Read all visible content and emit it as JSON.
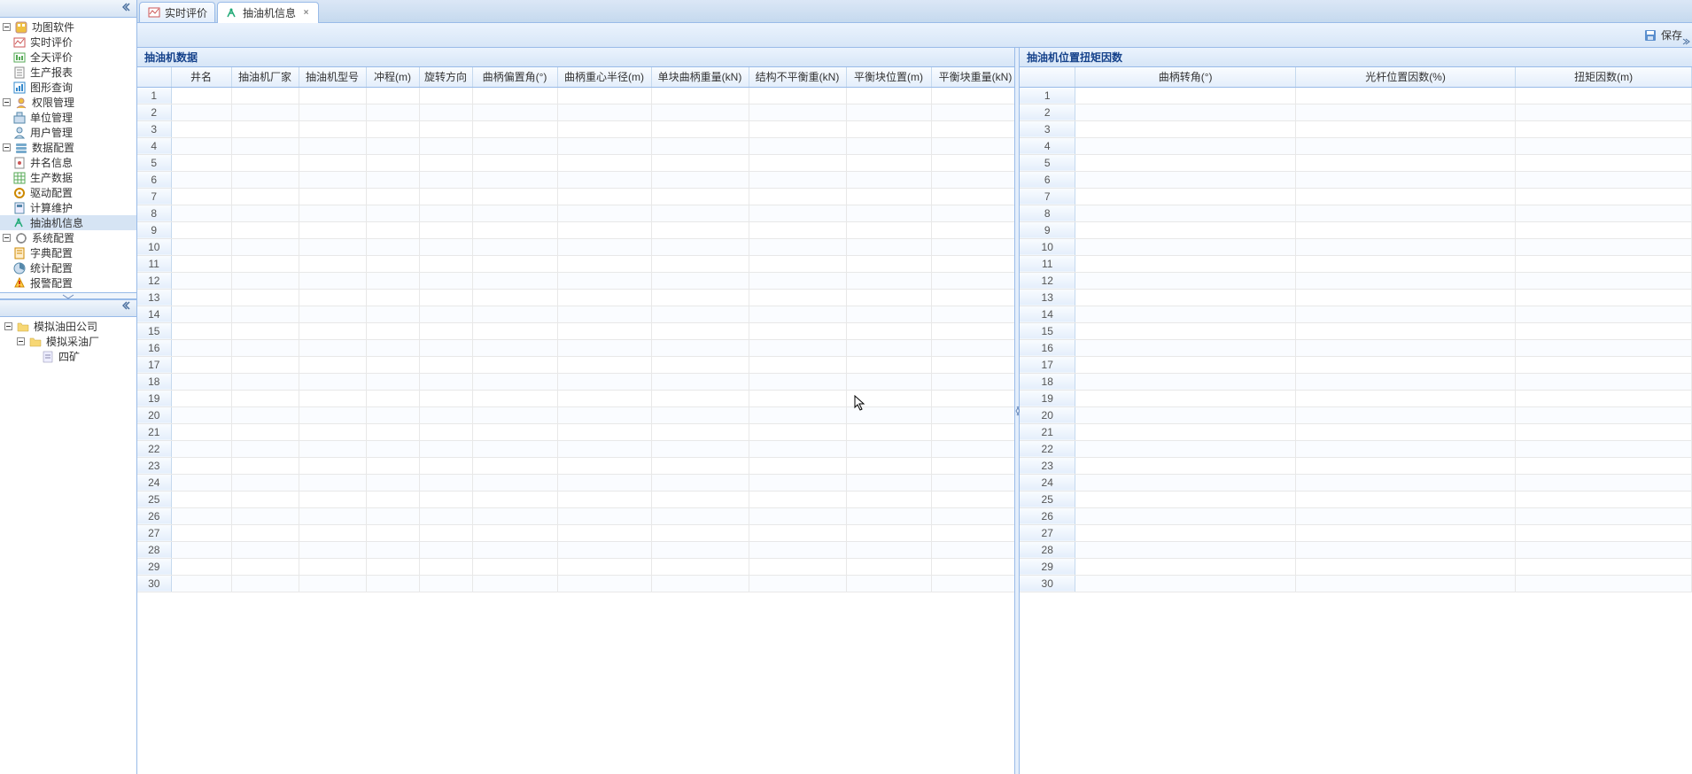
{
  "sidebar": {
    "tree1": [
      {
        "label": "功图软件",
        "icon": "app",
        "indent": 0,
        "expandable": true
      },
      {
        "label": "实时评价",
        "icon": "realtime",
        "indent": 1
      },
      {
        "label": "全天评价",
        "icon": "allday",
        "indent": 1
      },
      {
        "label": "生产报表",
        "icon": "report",
        "indent": 1
      },
      {
        "label": "图形查询",
        "icon": "chart",
        "indent": 1
      },
      {
        "label": "权限管理",
        "icon": "auth",
        "indent": 0,
        "expandable": true
      },
      {
        "label": "单位管理",
        "icon": "unit",
        "indent": 1
      },
      {
        "label": "用户管理",
        "icon": "user",
        "indent": 1
      },
      {
        "label": "数据配置",
        "icon": "dataconf",
        "indent": 0,
        "expandable": true
      },
      {
        "label": "井名信息",
        "icon": "well",
        "indent": 1
      },
      {
        "label": "生产数据",
        "icon": "proddata",
        "indent": 1
      },
      {
        "label": "驱动配置",
        "icon": "drive",
        "indent": 1
      },
      {
        "label": "计算维护",
        "icon": "calc",
        "indent": 1
      },
      {
        "label": "抽油机信息",
        "icon": "pump",
        "indent": 1,
        "selected": true
      },
      {
        "label": "系统配置",
        "icon": "sysconf",
        "indent": 0,
        "expandable": true
      },
      {
        "label": "字典配置",
        "icon": "dict",
        "indent": 1
      },
      {
        "label": "统计配置",
        "icon": "stat",
        "indent": 1
      },
      {
        "label": "报警配置",
        "icon": "alarm",
        "indent": 1
      }
    ],
    "tree2": [
      {
        "label": "模拟油田公司",
        "icon": "folder",
        "indent": 0,
        "expandable": true
      },
      {
        "label": "模拟采油厂",
        "icon": "folder",
        "indent": 1,
        "expandable": true
      },
      {
        "label": "四矿",
        "icon": "leaf",
        "indent": 2
      }
    ]
  },
  "tabs": [
    {
      "label": "实时评价",
      "icon": "realtime",
      "closable": false,
      "active": false
    },
    {
      "label": "抽油机信息",
      "icon": "pump",
      "closable": true,
      "active": true
    }
  ],
  "toolbar": {
    "save_label": "保存"
  },
  "panels": {
    "left_title": "抽油机数据",
    "right_title": "抽油机位置扭矩因数"
  },
  "grid1": {
    "columns": [
      "井名",
      "抽油机厂家",
      "抽油机型号",
      "冲程(m)",
      "旋转方向",
      "曲柄偏置角(°)",
      "曲柄重心半径(m)",
      "单块曲柄重量(kN)",
      "结构不平衡重(kN)",
      "平衡块位置(m)",
      "平衡块重量(kN)"
    ],
    "row_count": 30
  },
  "grid2": {
    "columns": [
      "曲柄转角(°)",
      "光杆位置因数(%)",
      "扭矩因数(m)"
    ],
    "row_count": 30
  }
}
